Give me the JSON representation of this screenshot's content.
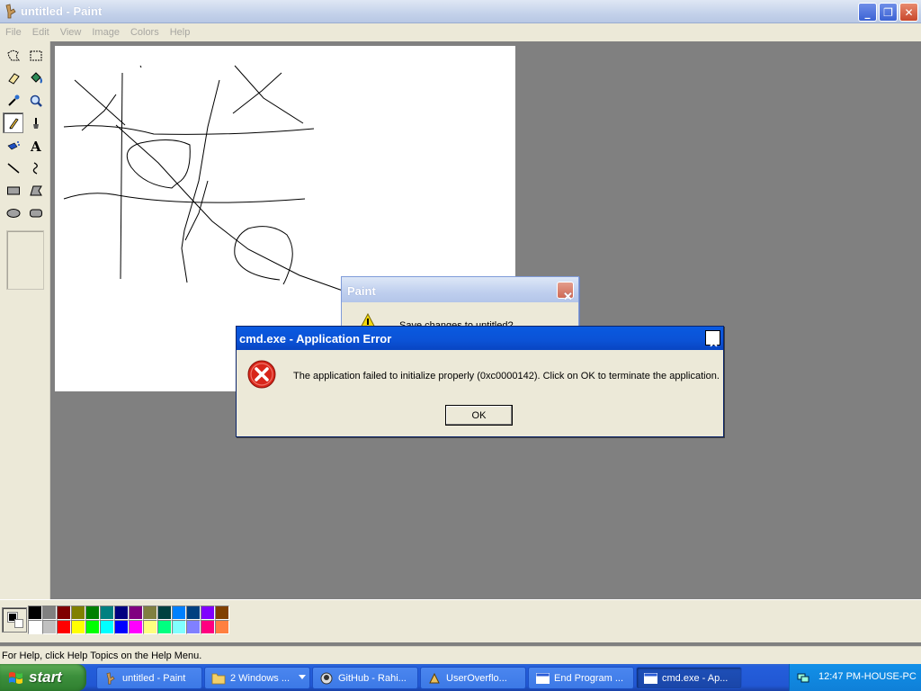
{
  "window": {
    "title": "untitled - Paint",
    "icon": "paint-icon",
    "minimize": "_",
    "maximize": "❐",
    "close": "✕"
  },
  "menu": [
    "File",
    "Edit",
    "View",
    "Image",
    "Colors",
    "Help"
  ],
  "tools": [
    {
      "name": "free-form-select"
    },
    {
      "name": "select"
    },
    {
      "name": "eraser"
    },
    {
      "name": "fill-with-color"
    },
    {
      "name": "pick-color"
    },
    {
      "name": "magnifier"
    },
    {
      "name": "pencil",
      "selected": true
    },
    {
      "name": "brush"
    },
    {
      "name": "airbrush"
    },
    {
      "name": "text"
    },
    {
      "name": "line"
    },
    {
      "name": "curve"
    },
    {
      "name": "rectangle"
    },
    {
      "name": "polygon"
    },
    {
      "name": "ellipse"
    },
    {
      "name": "rounded-rectangle"
    }
  ],
  "colors": {
    "foreground": "#000000",
    "background": "#ffffff",
    "palette": [
      "#000000",
      "#808080",
      "#800000",
      "#808000",
      "#008000",
      "#008080",
      "#000080",
      "#800080",
      "#808040",
      "#004040",
      "#0080ff",
      "#004080",
      "#8000ff",
      "#804000",
      "#ffffff",
      "#c0c0c0",
      "#ff0000",
      "#ffff00",
      "#00ff00",
      "#00ffff",
      "#0000ff",
      "#ff00ff",
      "#ffff80",
      "#00ff80",
      "#80ffff",
      "#8080ff",
      "#ff0080",
      "#ff8040"
    ]
  },
  "status": "For Help, click Help Topics on the Help Menu.",
  "paint_dialog": {
    "title": "Paint",
    "message": "Save changes to untitled?",
    "icon": "warning-icon"
  },
  "error_dialog": {
    "title": "cmd.exe - Application Error",
    "message": "The application failed to initialize properly (0xc0000142). Click on OK to terminate the application.",
    "ok": "OK",
    "close": "✕",
    "icon": "error-icon"
  },
  "taskbar": {
    "start": "start",
    "tasks": [
      {
        "label": "untitled - Paint",
        "icon": "paint-icon"
      },
      {
        "label": "2 Windows ...",
        "icon": "folder-icon",
        "group": true
      },
      {
        "label": "GitHub - Rahi...",
        "icon": "github-icon"
      },
      {
        "label": "UserOverflo...",
        "icon": "app-icon"
      },
      {
        "label": "End Program ...",
        "icon": "window-icon"
      },
      {
        "label": "cmd.exe - Ap...",
        "icon": "window-icon",
        "active": true
      }
    ],
    "clock": "12:47 PM-HOUSE-PC"
  }
}
